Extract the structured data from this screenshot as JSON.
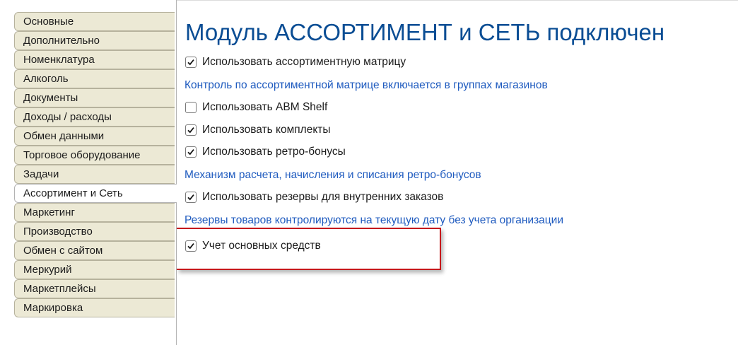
{
  "sidebar": {
    "tabs": [
      {
        "label": "Основные"
      },
      {
        "label": "Дополнительно"
      },
      {
        "label": "Номенклатура"
      },
      {
        "label": "Алкоголь"
      },
      {
        "label": "Документы"
      },
      {
        "label": "Доходы / расходы"
      },
      {
        "label": "Обмен данными"
      },
      {
        "label": "Торговое оборудование"
      },
      {
        "label": "Задачи"
      },
      {
        "label": "Ассортимент и Сеть"
      },
      {
        "label": "Маркетинг"
      },
      {
        "label": "Производство"
      },
      {
        "label": "Обмен с сайтом"
      },
      {
        "label": "Меркурий"
      },
      {
        "label": "Маркетплейсы"
      },
      {
        "label": "Маркировка"
      }
    ],
    "active_tab": "Ассортимент и Сеть"
  },
  "main": {
    "title": "Модуль АССОРТИМЕНТ и СЕТЬ подключен",
    "options": {
      "assortment_matrix": {
        "label": "Использовать ассортиментную матрицу",
        "checked": true
      },
      "abm_shelf": {
        "label": "Использовать ABM Shelf",
        "checked": false
      },
      "kits": {
        "label": "Использовать комплекты",
        "checked": true
      },
      "retro_bonuses": {
        "label": "Использовать ретро-бонусы",
        "checked": true
      },
      "internal_reserves": {
        "label": "Использовать резервы для внутренних заказов",
        "checked": true
      },
      "fixed_assets": {
        "label": "Учет основных средств",
        "checked": true
      }
    },
    "links": {
      "matrix_control": "Контроль по ассортиментной матрице включается в группах магазинов",
      "retro_mechanism": "Механизм расчета, начисления и списания ретро-бонусов",
      "reserves_note": "Резервы товаров контролируются на текущую дату без учета организации"
    }
  },
  "colors": {
    "title": "#0a4d94",
    "link": "#1f5bbf",
    "tab_bg": "#ece9d5",
    "highlight": "#c5181c"
  }
}
